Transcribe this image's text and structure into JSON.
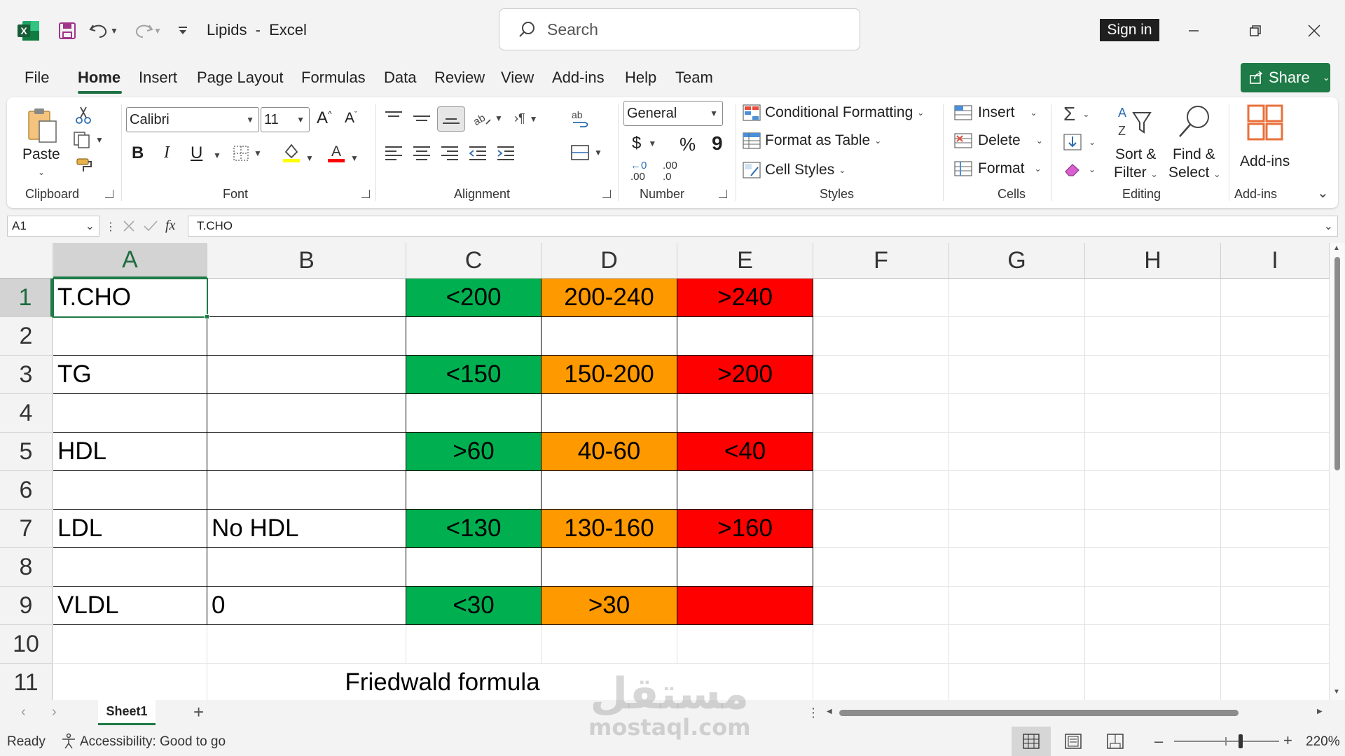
{
  "app": {
    "document_name": "Lipids",
    "app_name": "Excel",
    "separator": "-"
  },
  "search": {
    "placeholder": "Search"
  },
  "account": {
    "sign_in_label": "Sign in"
  },
  "menu": {
    "tabs": [
      "File",
      "Home",
      "Insert",
      "Page Layout",
      "Formulas",
      "Data",
      "Review",
      "View",
      "Add-ins",
      "Help",
      "Team"
    ],
    "active_tab": "Home",
    "share_label": "Share"
  },
  "ribbon": {
    "clipboard": {
      "label": "Clipboard",
      "paste_label": "Paste"
    },
    "font": {
      "label": "Font",
      "font_name": "Calibri",
      "font_size": "11",
      "bold": "B",
      "italic": "I",
      "underline": "U"
    },
    "alignment": {
      "label": "Alignment"
    },
    "number": {
      "label": "Number",
      "format": "General",
      "currency": "$",
      "percent": "%",
      "comma": "9",
      "inc_decimal": ".00",
      "dec_decimal": ".0"
    },
    "styles": {
      "label": "Styles",
      "conditional_formatting": "Conditional Formatting",
      "format_as_table": "Format as Table",
      "cell_styles": "Cell Styles"
    },
    "cells": {
      "label": "Cells",
      "insert": "Insert",
      "delete": "Delete",
      "format": "Format"
    },
    "editing": {
      "label": "Editing",
      "sort_filter_line1": "Sort &",
      "sort_filter_line2": "Filter",
      "find_select_line1": "Find &",
      "find_select_line2": "Select"
    },
    "addins": {
      "label": "Add-ins",
      "button": "Add-ins"
    }
  },
  "formula_bar": {
    "name_box": "A1",
    "fx": "fx",
    "content": "T.CHO"
  },
  "sheet": {
    "columns": [
      "A",
      "B",
      "C",
      "D",
      "E",
      "F",
      "G",
      "H",
      "I"
    ],
    "rows": [
      "1",
      "2",
      "3",
      "4",
      "5",
      "6",
      "7",
      "8",
      "9",
      "10",
      "11"
    ],
    "selected_cell": "A1",
    "colors": {
      "green": "#00b050",
      "orange": "#ff9900",
      "red": "#ff0000",
      "accent": "#217346"
    },
    "data_rows": [
      {
        "row": "1",
        "a": "T.CHO",
        "b": "",
        "c": "<200",
        "d": "200-240",
        "e": ">240"
      },
      {
        "row": "2",
        "a": "",
        "b": "",
        "c": "",
        "d": "",
        "e": ""
      },
      {
        "row": "3",
        "a": "TG",
        "b": "",
        "c": "<150",
        "d": "150-200",
        "e": ">200"
      },
      {
        "row": "4",
        "a": "",
        "b": "",
        "c": "",
        "d": "",
        "e": ""
      },
      {
        "row": "5",
        "a": "HDL",
        "b": "",
        "c": ">60",
        "d": "40-60",
        "e": "<40"
      },
      {
        "row": "6",
        "a": "",
        "b": "",
        "c": "",
        "d": "",
        "e": ""
      },
      {
        "row": "7",
        "a": "LDL",
        "b": "No HDL",
        "c": "<130",
        "d": "130-160",
        "e": ">160"
      },
      {
        "row": "8",
        "a": "",
        "b": "",
        "c": "",
        "d": "",
        "e": ""
      },
      {
        "row": "9",
        "a": "VLDL",
        "b": "0",
        "c": "<30",
        "d": ">30",
        "e": ""
      }
    ],
    "row11_note": "Friedwald formula"
  },
  "sheet_tabs": {
    "active": "Sheet1",
    "add": "+"
  },
  "status": {
    "ready": "Ready",
    "accessibility": "Accessibility: Good to go",
    "zoom": "220%"
  },
  "watermark": {
    "arabic": "مستقل",
    "latin": "mostaql.com"
  }
}
